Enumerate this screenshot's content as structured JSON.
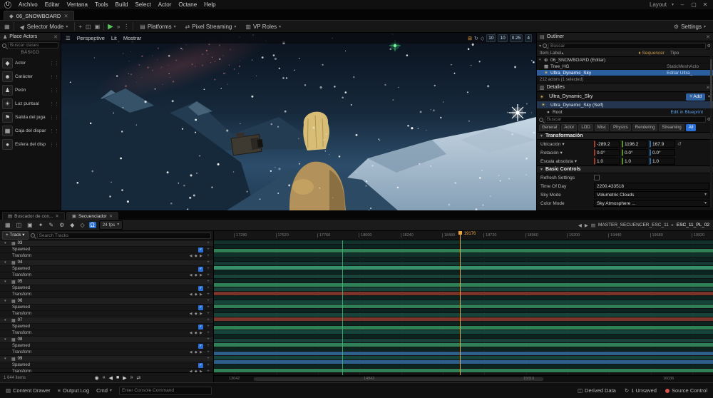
{
  "menubar": {
    "items": [
      "Archivo",
      "Editar",
      "Ventana",
      "Tools",
      "Build",
      "Select",
      "Actor",
      "Octane",
      "Help"
    ],
    "layout_label": "Layout",
    "window_buttons": [
      "–",
      "▢",
      "✕"
    ]
  },
  "tabbar": {
    "level_tab": "06_SNOWBOARD"
  },
  "toolbar": {
    "selector_mode": "Selector Mode",
    "platforms": "Platforms",
    "pixel_streaming": "Pixel Streaming",
    "vp_roles": "VP Roles",
    "settings": "Settings"
  },
  "place_actors": {
    "title": "Place Actors",
    "search_placeholder": "Buscar clases",
    "category": "BÁSICO",
    "items": [
      {
        "label": "Actor",
        "icon": "◆"
      },
      {
        "label": "Carácter",
        "icon": "☻"
      },
      {
        "label": "Peón",
        "icon": "♟"
      },
      {
        "label": "Luz puntual",
        "icon": "☀"
      },
      {
        "label": "Salida del juga",
        "icon": "⚑"
      },
      {
        "label": "Caja del dispar",
        "icon": "▦"
      },
      {
        "label": "Esfera del disp",
        "icon": "●"
      }
    ]
  },
  "viewport": {
    "menu_label": "Perspective",
    "lit_label": "Lit",
    "show_label": "Mostrar",
    "badges": [
      "10",
      "10",
      "0.25",
      "4"
    ]
  },
  "outliner": {
    "tab_title": "Outliner",
    "search_placeholder": "Buscar",
    "columns": {
      "label": "Item Label",
      "sequencer": "Sequencer",
      "type": "Tipo"
    },
    "rows": [
      {
        "label": "06_SNOWBOARD (Editar)",
        "type": "",
        "icon": "world",
        "caret": true,
        "selected": false
      },
      {
        "label": "Tree_HG",
        "type": "StaticMeshActo",
        "icon": "mesh",
        "caret": false,
        "selected": false
      },
      {
        "label": "Ultra_Dynamic_Sky",
        "type": "Editar Ultra_",
        "icon": "sun",
        "caret": false,
        "selected": true
      }
    ],
    "footer": "212 actors (1 selected)"
  },
  "details": {
    "tab_title": "Detalles",
    "actor_name": "Ultra_Dynamic_Sky",
    "add_label": "+ Add",
    "self_row": "Ultra_Dynamic_Sky (Self)",
    "root_row": "Root",
    "edit_blueprint": "Edit in Blueprint",
    "search_placeholder": "Buscar",
    "filters": [
      "General",
      "Actor",
      "LOD",
      "Misc",
      "Physics",
      "Rendering",
      "Streaming",
      "All"
    ],
    "active_filter": "All",
    "transform": {
      "title": "Transformación",
      "rows": [
        {
          "label": "Ubicación",
          "x": "-289.2",
          "y": "1196.2",
          "z": "167.9",
          "reset": true
        },
        {
          "label": "Rotación",
          "x": "0.0°",
          "y": "0.0°",
          "z": "0.0°",
          "reset": false
        },
        {
          "label": "Escala absoluta",
          "x": "1.0",
          "y": "1.0",
          "z": "1.0",
          "reset": false
        }
      ]
    },
    "basic_controls": {
      "title": "Basic Controls",
      "rows": [
        {
          "label": "Refresh Settings",
          "type": "check",
          "value": ""
        },
        {
          "label": "Time Of Day",
          "type": "number",
          "value": "2200.433518"
        },
        {
          "label": "Sky Mode",
          "type": "dropdown",
          "value": "Volumetric Clouds"
        },
        {
          "label": "Color Mode",
          "type": "dropdown",
          "value": "Sky Atmosphere ..."
        }
      ]
    }
  },
  "sequencer": {
    "tabs": [
      {
        "label": "Buscador de con...",
        "active": false
      },
      {
        "label": "Secuenciador",
        "active": true
      }
    ],
    "toolbar_icons": [
      {
        "name": "save-icon",
        "glyph": "▦",
        "active": false
      },
      {
        "name": "find-in-content-browser-icon",
        "glyph": "◫",
        "active": false
      },
      {
        "name": "render-movie-icon",
        "glyph": "▣",
        "active": false
      },
      {
        "name": "actions-icon",
        "glyph": "✦",
        "active": false
      },
      {
        "name": "edit-icon",
        "glyph": "✎",
        "active": false
      },
      {
        "name": "options-icon",
        "glyph": "⚙",
        "active": false
      },
      {
        "name": "keyframe-options-icon",
        "glyph": "◆",
        "active": false
      },
      {
        "name": "auto-key-icon",
        "glyph": "◇",
        "active": false
      },
      {
        "name": "snap-icon",
        "glyph": "Ω",
        "active": true
      }
    ],
    "fps_label": "24 fps",
    "breadcrumb": {
      "root": "MASTER_SECUENCER_ESC_11",
      "current": "ESC_11_PL_02"
    },
    "add_track_label": "+ Track",
    "search_placeholder": "Search Tracks",
    "items_count": "1 644 items",
    "playhead": {
      "label": "19176",
      "frac": 0.493
    },
    "marker_frac": 0.257,
    "ruler_labels": [
      "17280",
      "17520",
      "17760",
      "18000",
      "18240",
      "18480",
      "18720",
      "18960",
      "19200",
      "19440",
      "19680",
      "19920"
    ],
    "range_labels": [
      {
        "label": "13042",
        "frac": 0.03
      },
      {
        "label": "14042",
        "frac": 0.3
      },
      {
        "label": "15019",
        "frac": 0.62
      },
      {
        "label": "16036",
        "frac": 0.9
      }
    ],
    "groups": [
      "03",
      "04",
      "05",
      "06",
      "07",
      "08",
      "09"
    ],
    "group_child_rows": [
      "Spawned",
      "Transform"
    ],
    "transport": [
      {
        "name": "loop-icon",
        "glyph": "◉"
      },
      {
        "name": "to-start-icon",
        "glyph": "«"
      },
      {
        "name": "step-back-icon",
        "glyph": "◀"
      },
      {
        "name": "stop-icon",
        "glyph": "■"
      },
      {
        "name": "play-icon",
        "glyph": "▶"
      },
      {
        "name": "to-end-icon",
        "glyph": "»"
      },
      {
        "name": "playback-mode-icon",
        "glyph": "⇄"
      }
    ],
    "stripes": [
      "#11312b",
      "#0c241f",
      "#2f8057",
      "#11312b",
      "#0c241f",
      "#123a33",
      "#35906b",
      "#0c241f",
      "#16443a",
      "#0c241f",
      "#2f8057",
      "#16443a",
      "#7a352b",
      "#0c241f",
      "#16443a",
      "#2f8057",
      "#0c241f",
      "#16443a",
      "#7a352b",
      "#0c241f",
      "#2f8057",
      "#16443a",
      "#0c241f",
      "#16443a",
      "#2f8057",
      "#0c241f",
      "#2c5f8a",
      "#16443a",
      "#2c5f8a",
      "#0c241f",
      "#2f8057"
    ]
  },
  "statusbar": {
    "content_drawer": "Content Drawer",
    "output_log": "Output Log",
    "cmd_label": "Cmd",
    "cmd_placeholder": "Enter Console Command",
    "derived_data": "Derived Data",
    "unsaved": "1 Unsaved",
    "source_control": "Source Control"
  }
}
